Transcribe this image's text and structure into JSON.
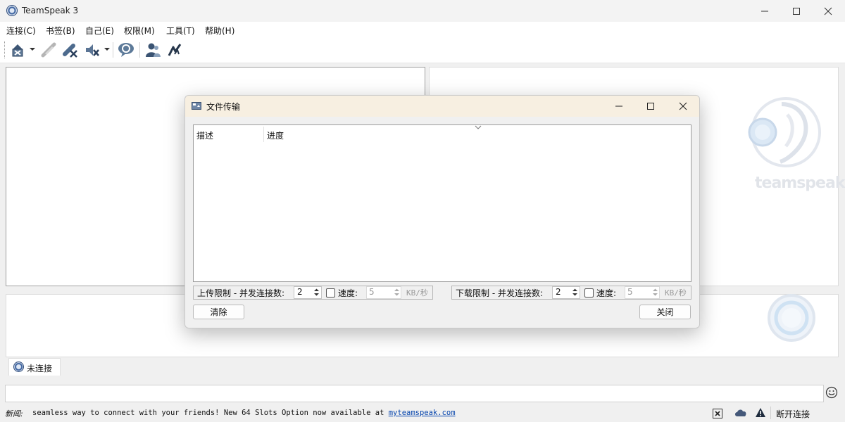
{
  "window": {
    "title": "TeamSpeak 3"
  },
  "menu": [
    "连接(C)",
    "书签(B)",
    "自己(E)",
    "权限(M)",
    "工具(T)",
    "帮助(H)"
  ],
  "icons": {
    "toolbar": [
      "connect-icon",
      "disconnect-icon",
      "away-icon",
      "mute-microphone-icon",
      "mute-speakers-icon",
      "subscribe-icon",
      "contacts-icon",
      "whisper-icon"
    ]
  },
  "brand": {
    "wordmark": "teamspeak"
  },
  "tabs": [
    {
      "label": "未连接"
    }
  ],
  "dialog": {
    "title": "文件传输",
    "columns": [
      "描述",
      "进度"
    ],
    "upload": {
      "label": "上传限制 - 并发连接数:",
      "connections": "2",
      "speed_label": "速度:",
      "speed": "5",
      "unit": "KB/秒"
    },
    "download": {
      "label": "下载限制 - 并发连接数:",
      "connections": "2",
      "speed_label": "速度:",
      "speed": "5",
      "unit": "KB/秒"
    },
    "clear_button": "清除",
    "close_button": "关闭"
  },
  "statusbar": {
    "news_label": "新闻:",
    "news_text": "seamless way to connect with your friends! New 64 Slots Option now available at",
    "news_link": "myteamspeak.com",
    "status": "断开连接"
  },
  "colors": {
    "accent": "#3c63a0",
    "dialog_title_bg": "#f7efe1",
    "link": "#0645ad"
  }
}
